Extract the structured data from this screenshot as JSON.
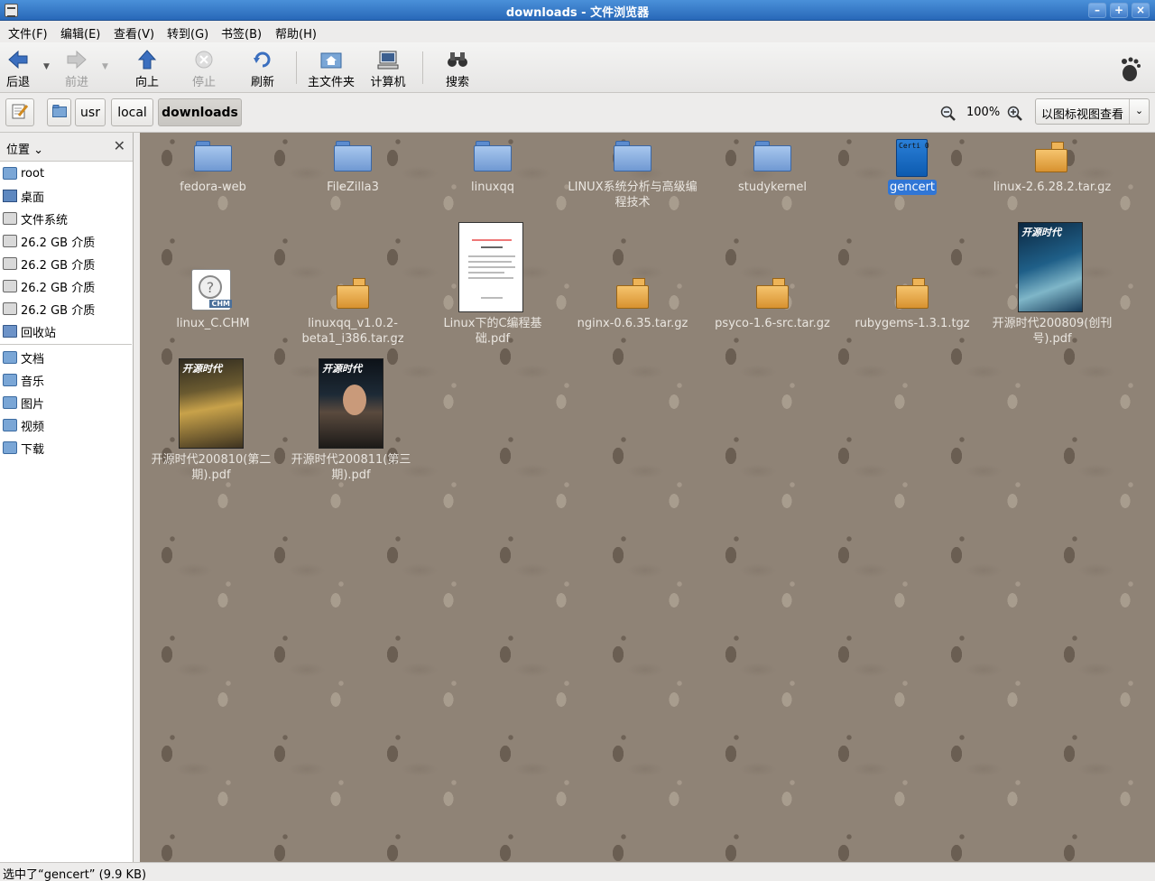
{
  "window": {
    "title": "downloads - 文件浏览器",
    "minimize": "–",
    "maximize": "+",
    "close": "×"
  },
  "menu": [
    "文件(F)",
    "编辑(E)",
    "查看(V)",
    "转到(G)",
    "书签(B)",
    "帮助(H)"
  ],
  "toolbar": {
    "back": "后退",
    "forward": "前进",
    "up": "向上",
    "stop": "停止",
    "reload": "刷新",
    "home": "主文件夹",
    "computer": "计算机",
    "search": "搜索"
  },
  "path": [
    "usr",
    "local",
    "downloads"
  ],
  "zoom": "100%",
  "view_mode": "以图标视图查看",
  "sidebar": {
    "header": "位置",
    "places": [
      "root",
      "桌面",
      "文件系统",
      "26.2 GB 介质",
      "26.2 GB 介质",
      "26.2 GB 介质",
      "26.2 GB 介质",
      "回收站"
    ],
    "bookmarks": [
      "文档",
      "音乐",
      "图片",
      "视频",
      "下载"
    ]
  },
  "files": [
    {
      "name": "fedora-web",
      "type": "folder"
    },
    {
      "name": "FileZilla3",
      "type": "folder"
    },
    {
      "name": "linuxqq",
      "type": "folder"
    },
    {
      "name": "LINUX系统分析与高级编程技术",
      "type": "folder"
    },
    {
      "name": "studykernel",
      "type": "folder"
    },
    {
      "name": "gencert",
      "type": "binary",
      "selected": true,
      "icon_text": "Certi 0"
    },
    {
      "name": "linux-2.6.28.2.tar.gz",
      "type": "archive"
    },
    {
      "name": "linux_C.CHM",
      "type": "chm",
      "icon_text": "CHM"
    },
    {
      "name": "linuxqq_v1.0.2-beta1_i386.tar.gz",
      "type": "archive"
    },
    {
      "name": "Linux下的C编程基础.pdf",
      "type": "pdf"
    },
    {
      "name": "nginx-0.6.35.tar.gz",
      "type": "archive"
    },
    {
      "name": "psyco-1.6-src.tar.gz",
      "type": "archive"
    },
    {
      "name": "rubygems-1.3.1.tgz",
      "type": "archive"
    },
    {
      "name": "开源时代200809(创刊号).pdf",
      "type": "magazine",
      "cover_title": "开源时代"
    },
    {
      "name": "开源时代200810(第二期).pdf",
      "type": "magazine",
      "cover_title": "开源时代"
    },
    {
      "name": "开源时代200811(第三期).pdf",
      "type": "magazine",
      "cover_title": "开源时代"
    }
  ],
  "status": "选中了“gencert” (9.9 KB)"
}
